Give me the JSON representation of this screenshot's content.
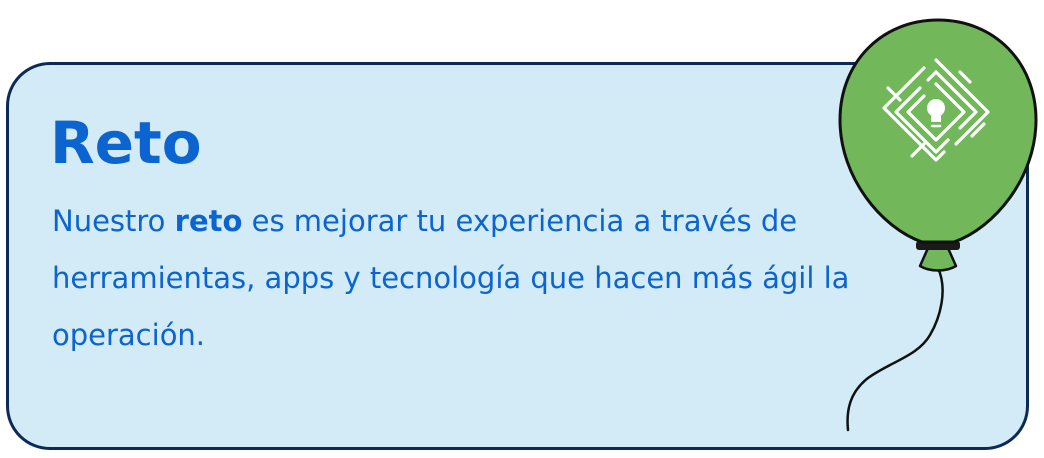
{
  "card": {
    "title": "Reto",
    "text_before": "Nuestro ",
    "text_bold": "reto",
    "text_after": " es mejorar tu experiencia a través de herramientas, apps y tecnología que hacen más ágil la operación."
  },
  "balloon": {
    "icon": "maze-lightbulb-icon"
  },
  "colors": {
    "card_background": "#d2ebf7",
    "card_border": "#0b2a57",
    "text": "#0b64cf",
    "balloon": "#72b85a",
    "outline": "#111111"
  }
}
